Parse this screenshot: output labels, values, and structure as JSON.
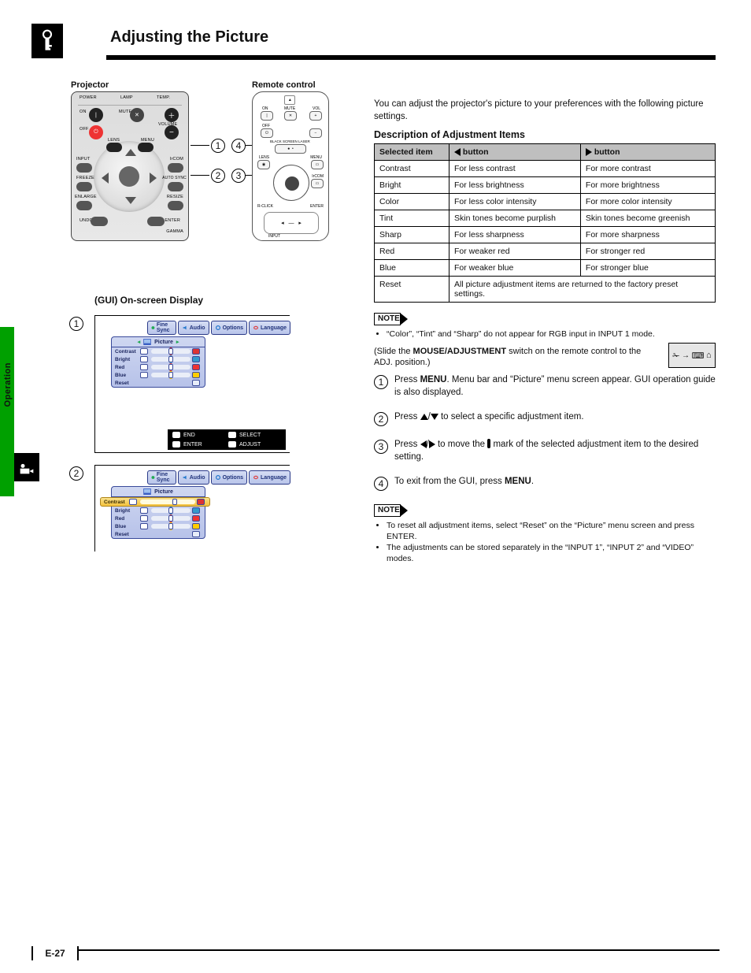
{
  "page": {
    "title": "Adjusting the Picture",
    "section_sidebar": "Operation",
    "number": "E-27"
  },
  "hardware": {
    "projector_label": "Projector",
    "remote_label": "Remote control",
    "projector_buttons": {
      "power_led": "POWER",
      "lamp_led": "LAMP",
      "temp_led": "TEMP.",
      "on": "ON",
      "mute": "MUTE",
      "volume": "VOLUME",
      "off": "OFF",
      "lens": "LENS",
      "menu": "MENU",
      "input": "INPUT",
      "ircom": "IrCOM",
      "freeze": "FREEZE",
      "auto_sync": "AUTO SYNC",
      "enlarge": "ENLARGE",
      "resize": "RESIZE",
      "undo": "UNDO",
      "enter": "ENTER",
      "gamma": "GAMMA"
    },
    "remote_buttons": {
      "on": "ON",
      "vol": "VOL",
      "off": "OFF",
      "mute": "MUTE",
      "black_screen_laser": "BLACK SCREEN LASER",
      "lens": "LENS",
      "menu": "MENU",
      "ircom": "IrCOM",
      "rclick": "R-CLICK",
      "enter": "ENTER",
      "input": "INPUT"
    },
    "callouts": {
      "c1": "1",
      "c2": "2",
      "c3": "3",
      "c4": "4"
    }
  },
  "gui": {
    "heading": "(GUI) On-screen Display",
    "tabs": [
      "Fine Sync",
      "Audio",
      "Options",
      "Language"
    ],
    "window_title": "Picture",
    "sliders": [
      {
        "name": "Contrast",
        "color": "#d33"
      },
      {
        "name": "Bright",
        "color": "#39c"
      },
      {
        "name": "Red",
        "color": "#e33"
      },
      {
        "name": "Blue",
        "color": "#fc0"
      },
      {
        "name": "Reset",
        "color": null
      }
    ],
    "helpbar": {
      "end": "END",
      "select": "SELECT",
      "enter": "ENTER",
      "adjust": "ADJUST"
    },
    "selected_item": "Contrast",
    "step1_num": "1",
    "step2_num": "2"
  },
  "right": {
    "intro": "You can adjust the projector's picture to your preferences with the following picture settings.",
    "table_heading": "Description of Adjustment Items",
    "table": {
      "headers": {
        "item": "Selected item",
        "left": "button",
        "right": "button"
      },
      "rows": [
        {
          "item": "Contrast",
          "left": "For less contrast",
          "right": "For more contrast"
        },
        {
          "item": "Bright",
          "left": "For less brightness",
          "right": "For more brightness"
        },
        {
          "item": "Color",
          "left": "For less color intensity",
          "right": "For more color intensity"
        },
        {
          "item": "Tint",
          "left": "Skin tones become purplish",
          "right": "Skin tones become greenish"
        },
        {
          "item": "Sharp",
          "left": "For less sharpness",
          "right": "For more sharpness"
        },
        {
          "item": "Red",
          "left": "For weaker red",
          "right": "For stronger red"
        },
        {
          "item": "Blue",
          "left": "For weaker blue",
          "right": "For stronger blue"
        },
        {
          "item": "Reset",
          "left": "All picture adjustment items are returned to the factory preset settings.",
          "right": ""
        }
      ]
    },
    "note_label": "NOTE",
    "note_items_1": [
      "“Color”, “Tint” and “Sharp” do not appear for RGB input in INPUT 1 mode."
    ],
    "mouse_hint": "(Slide the MOUSE/ADJUSTMENT switch on the remote control to the ADJ. position.)",
    "mouse_symbols": [
      "✁",
      "→",
      "⌨",
      "⌂"
    ],
    "steps": {
      "s1": "Press MENU. Menu bar and “Picture” menu screen appear. GUI operation guide is also displayed.",
      "s2_a": "Press ",
      "s2_b": " to select a specific adjustment item.",
      "s3_a": "Press ",
      "s3_b": " to move the  mark of the selected adjustment item to the desired setting.",
      "s4": "To exit from the GUI, press MENU."
    },
    "note_items_2": [
      "To reset all adjustment items, select “Reset” on the “Picture” menu screen and press ENTER.",
      "The adjustments can be stored separately in the “INPUT 1”, “INPUT 2” and “VIDEO” modes."
    ]
  }
}
